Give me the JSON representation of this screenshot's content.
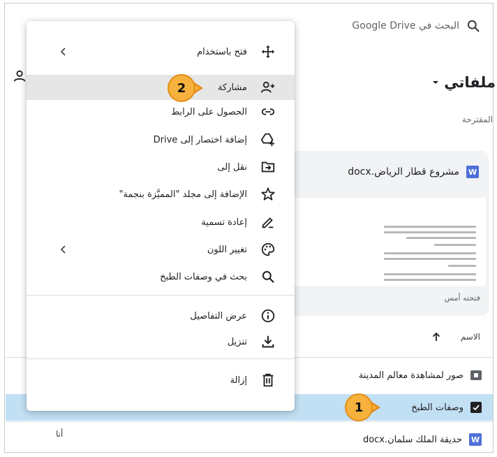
{
  "search": {
    "placeholder": "البحث في Google Drive",
    "icon": "search-icon"
  },
  "header": {
    "title": "ملفاتي"
  },
  "suggested": {
    "label": "المقترحة",
    "card": {
      "file_name": "مشروع قطار الرياض.docx",
      "file_badge": "W",
      "opened_label": "فتحته أمس"
    }
  },
  "list": {
    "sort_label": "الاسم",
    "rows": [
      {
        "name": "صور لمشاهدة معالم المدينة",
        "type": "folder"
      },
      {
        "name": "وصفات الطبخ",
        "type": "folder",
        "selected": true
      },
      {
        "name": "حديقة الملك سلمان.docx",
        "type": "docx",
        "badge": "W",
        "owner": "أنا"
      }
    ]
  },
  "menu": {
    "items": [
      {
        "label": "فتح باستخدام",
        "icon": "move-icon",
        "submenu": true
      },
      {
        "label": "مشاركة",
        "icon": "person-add-icon",
        "highlighted": true
      },
      {
        "label": "الحصول على الرابط",
        "icon": "link-icon"
      },
      {
        "label": "إضافة اختصار إلى Drive",
        "icon": "add-to-drive-icon"
      },
      {
        "label": "نقل إلى",
        "icon": "move-to-folder-icon"
      },
      {
        "label": "الإضافة إلى مجلد \"المميَّزة بنجمة\"",
        "icon": "star-icon"
      },
      {
        "label": "إعادة تسمية",
        "icon": "rename-icon"
      },
      {
        "label": "تغيير اللون",
        "icon": "palette-icon",
        "submenu": true
      },
      {
        "label": "بحث في وصفات الطبخ",
        "icon": "search-icon"
      },
      {
        "label": "عرض التفاصيل",
        "icon": "info-icon"
      },
      {
        "label": "تنزيل",
        "icon": "download-icon"
      },
      {
        "label": "إزالة",
        "icon": "trash-icon"
      }
    ]
  },
  "callouts": {
    "first": "1",
    "second": "2"
  },
  "colors": {
    "callout_fill": "#f6b23c",
    "selected_row": "#c2e0f4",
    "word_badge": "#4f6fd8",
    "menu_highlight": "#e6e6e6"
  }
}
